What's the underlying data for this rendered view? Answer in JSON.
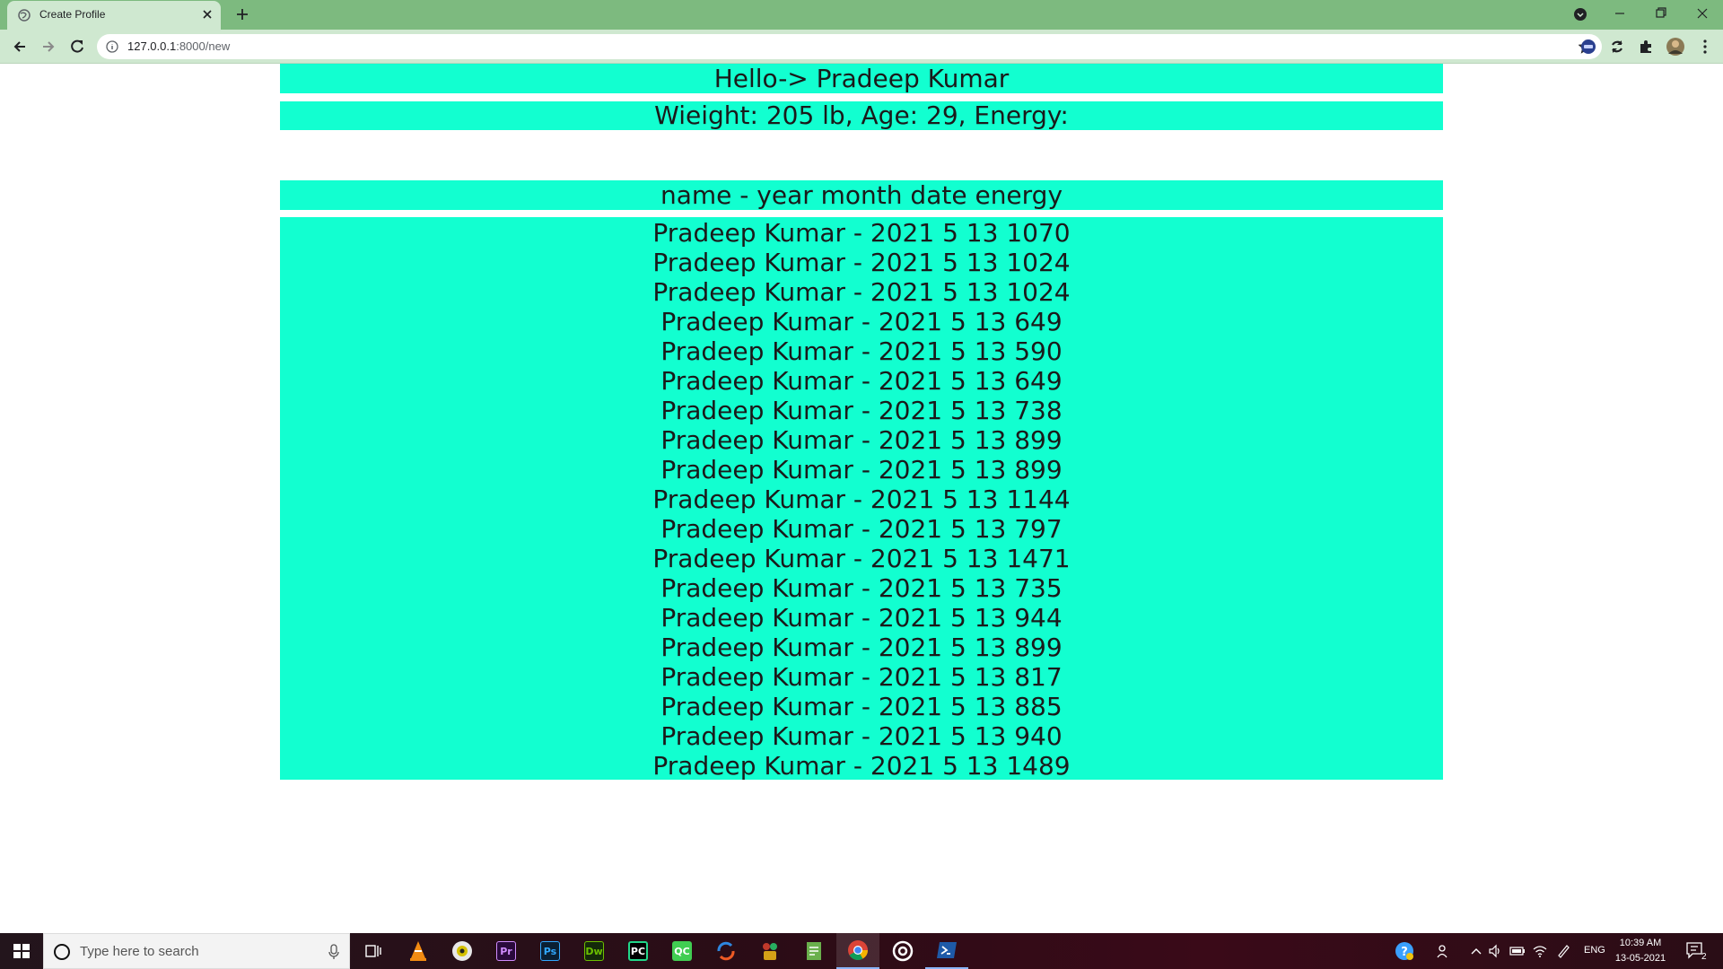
{
  "browser": {
    "tab_title": "Create Profile",
    "url_host": "127.0.0.1",
    "url_path": ":8000/new"
  },
  "page": {
    "greeting": "Hello-> Pradeep Kumar",
    "stats": "Wieight: 205 lb, Age: 29, Energy:",
    "table_header": "name - year month date energy",
    "entries": [
      "Pradeep Kumar - 2021 5 13 1070",
      "Pradeep Kumar - 2021 5 13 1024",
      "Pradeep Kumar - 2021 5 13 1024",
      "Pradeep Kumar - 2021 5 13 649",
      "Pradeep Kumar - 2021 5 13 590",
      "Pradeep Kumar - 2021 5 13 649",
      "Pradeep Kumar - 2021 5 13 738",
      "Pradeep Kumar - 2021 5 13 899",
      "Pradeep Kumar - 2021 5 13 899",
      "Pradeep Kumar - 2021 5 13 1144",
      "Pradeep Kumar - 2021 5 13 797",
      "Pradeep Kumar - 2021 5 13 1471",
      "Pradeep Kumar - 2021 5 13 735",
      "Pradeep Kumar - 2021 5 13 944",
      "Pradeep Kumar - 2021 5 13 899",
      "Pradeep Kumar - 2021 5 13 817",
      "Pradeep Kumar - 2021 5 13 885",
      "Pradeep Kumar - 2021 5 13 940",
      "Pradeep Kumar - 2021 5 13 1489"
    ]
  },
  "colors": {
    "bar_background": "#12ffd0",
    "tabstrip": "#7dba7f",
    "toolbar": "#cfe8d0"
  },
  "taskbar": {
    "search_placeholder": "Type here to search",
    "language": "ENG",
    "time": "10:39 AM",
    "date": "13-05-2021",
    "notification_count": "2",
    "apps": [
      {
        "icon": "vlc-icon",
        "label": ""
      },
      {
        "icon": "app-icon",
        "label": ""
      },
      {
        "icon": "premiere-icon",
        "label": "Pr"
      },
      {
        "icon": "photoshop-icon",
        "label": "Ps"
      },
      {
        "icon": "dreamweaver-icon",
        "label": "Dw"
      },
      {
        "icon": "pycharm-icon",
        "label": "PC"
      },
      {
        "icon": "qt-creator-icon",
        "label": "QC"
      }
    ]
  }
}
